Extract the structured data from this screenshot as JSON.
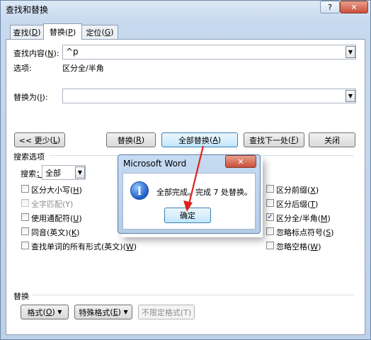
{
  "window": {
    "title": "查找和替换",
    "help": "?",
    "close": "✕"
  },
  "tabs": [
    {
      "label": "查找",
      "key": "D"
    },
    {
      "label": "替换",
      "key": "P"
    },
    {
      "label": "定位",
      "key": "G"
    }
  ],
  "find": {
    "label": "查找内容",
    "key": "N",
    "value": "^p",
    "options_label": "选项:",
    "options_value": "区分全/半角"
  },
  "replace": {
    "label": "替换为",
    "key": "I",
    "value": ""
  },
  "buttons": {
    "less": "<< 更少",
    "less_key": "L",
    "replace": "替换",
    "replace_key": "R",
    "replace_all": "全部替换",
    "replace_all_key": "A",
    "find_next": "查找下一处",
    "find_next_key": "F",
    "close": "关闭"
  },
  "search_options": {
    "header": "搜索选项",
    "search_label": "搜索",
    "search_key": "；",
    "search_value": "全部",
    "left": [
      {
        "label": "区分大小写",
        "key": "H",
        "checked": false,
        "disabled": false
      },
      {
        "label": "全字匹配",
        "key": "Y",
        "checked": false,
        "disabled": true
      },
      {
        "label": "使用通配符",
        "key": "U",
        "checked": false,
        "disabled": false
      },
      {
        "label": "同音(英文)",
        "key": "K",
        "checked": false,
        "disabled": false
      },
      {
        "label": "查找单词的所有形式(英文)",
        "key": "W",
        "checked": false,
        "disabled": false
      }
    ],
    "right": [
      {
        "label": "区分前缀",
        "key": "X",
        "checked": false
      },
      {
        "label": "区分后缀",
        "key": "T",
        "checked": false
      },
      {
        "label": "区分全/半角",
        "key": "M",
        "checked": true
      },
      {
        "label": "忽略标点符号",
        "key": "S",
        "checked": false
      },
      {
        "label": "忽略空格",
        "key": "W",
        "checked": false
      }
    ]
  },
  "replace_section": {
    "header": "替换",
    "format": "格式",
    "format_key": "O",
    "special": "特殊格式",
    "special_key": "E",
    "no_format": "不限定格式(T)"
  },
  "message_box": {
    "title": "Microsoft Word",
    "close": "✕",
    "icon": "info-icon",
    "text": "全部完成。完成 7 处替换。",
    "ok": "确定"
  },
  "colors": {
    "accent": "#3c7fb1",
    "arrow": "#e0201b",
    "checkmark": "#1a3f8a"
  }
}
